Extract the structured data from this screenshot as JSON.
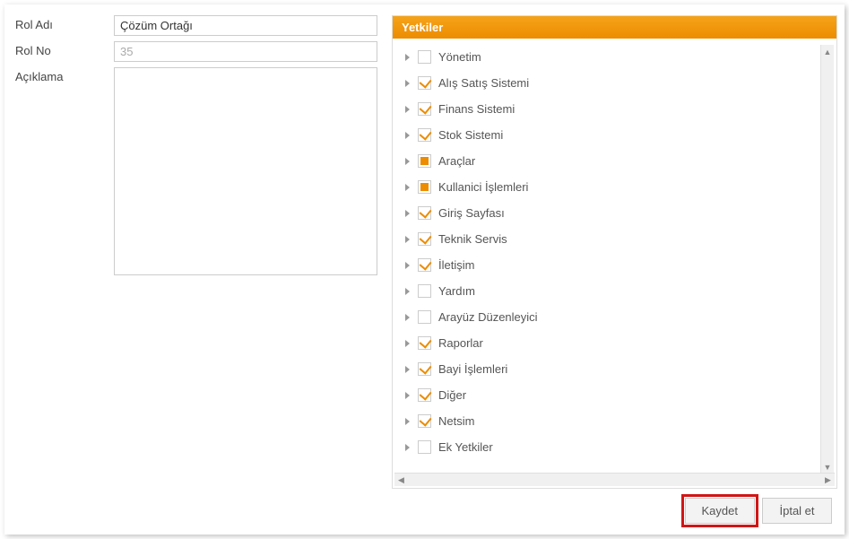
{
  "form": {
    "role_name_label": "Rol Adı",
    "role_name_value": "Çözüm Ortağı",
    "role_no_label": "Rol No",
    "role_no_value": "35",
    "description_label": "Açıklama",
    "description_value": ""
  },
  "permissions": {
    "header": "Yetkiler",
    "items": [
      {
        "label": "Yönetim",
        "state": "unchecked"
      },
      {
        "label": "Alış Satış Sistemi",
        "state": "checked"
      },
      {
        "label": "Finans Sistemi",
        "state": "checked"
      },
      {
        "label": "Stok Sistemi",
        "state": "checked"
      },
      {
        "label": "Araçlar",
        "state": "partial"
      },
      {
        "label": "Kullanici İşlemleri",
        "state": "partial"
      },
      {
        "label": "Giriş Sayfası",
        "state": "checked"
      },
      {
        "label": "Teknik Servis",
        "state": "checked"
      },
      {
        "label": "İletişim",
        "state": "checked"
      },
      {
        "label": "Yardım",
        "state": "unchecked"
      },
      {
        "label": "Arayüz Düzenleyici",
        "state": "unchecked"
      },
      {
        "label": "Raporlar",
        "state": "checked"
      },
      {
        "label": "Bayi İşlemleri",
        "state": "checked"
      },
      {
        "label": "Diğer",
        "state": "checked"
      },
      {
        "label": "Netsim",
        "state": "checked"
      },
      {
        "label": "Ek Yetkiler",
        "state": "unchecked"
      }
    ]
  },
  "buttons": {
    "save": "Kaydet",
    "cancel": "İptal et"
  }
}
